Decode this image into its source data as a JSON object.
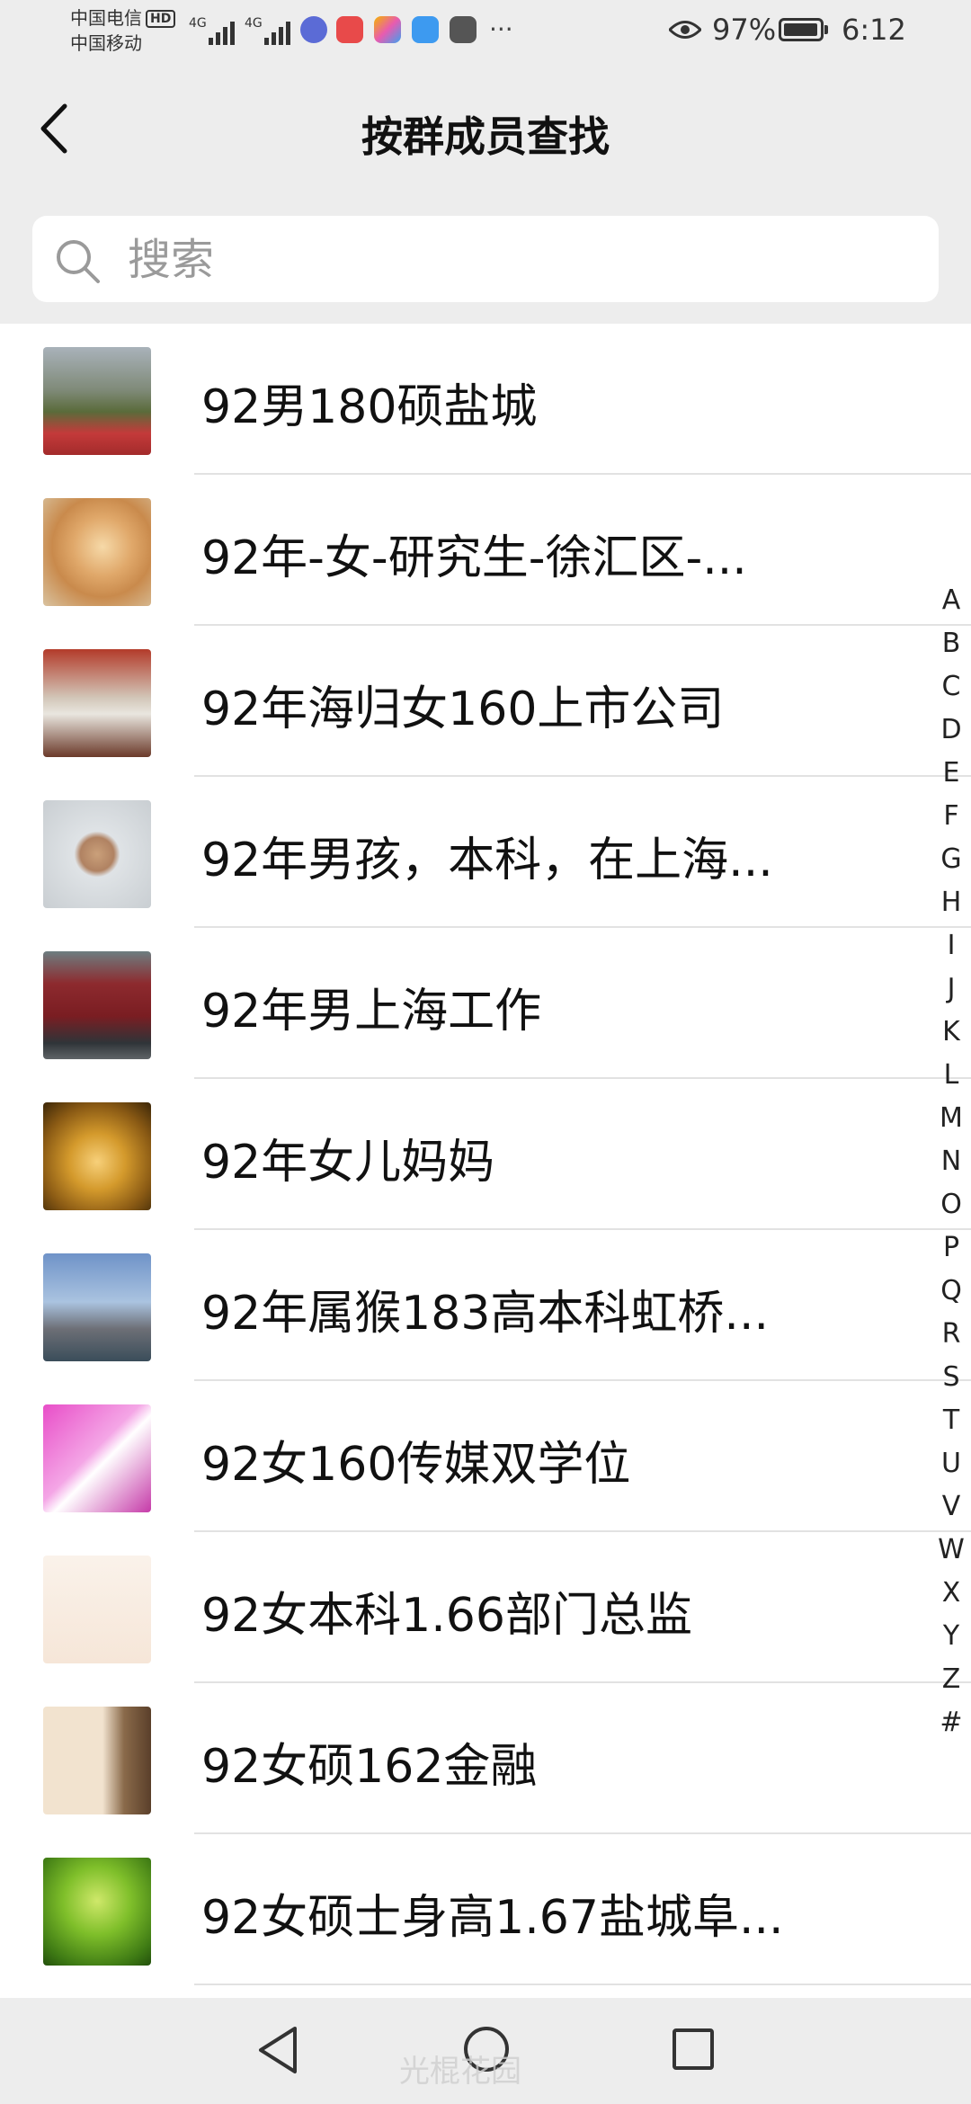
{
  "status_bar": {
    "carrier_1": "中国电信",
    "hd_badge": "HD",
    "carrier_2": "中国移动",
    "network_1": "4G",
    "network_2": "4G",
    "more": "···",
    "battery": "97%",
    "battery_level": 0.97,
    "time": "6:12"
  },
  "header": {
    "title": "按群成员查找"
  },
  "search": {
    "placeholder": "搜索",
    "value": ""
  },
  "members": [
    {
      "name": "92男180硕盐城",
      "avatar": "landscape-flowers"
    },
    {
      "name": "92年-女-研究生-徐汇区-...",
      "avatar": "kitten"
    },
    {
      "name": "92年海归女160上市公司",
      "avatar": "painting-waterfall"
    },
    {
      "name": "92年男孩，本科，在上海...",
      "avatar": "man-portrait"
    },
    {
      "name": "92年男上海工作",
      "avatar": "truck"
    },
    {
      "name": "92年女儿妈妈",
      "avatar": "golden-apple"
    },
    {
      "name": "92年属猴183高本科虹桥...",
      "avatar": "city-skyline"
    },
    {
      "name": "92女160传媒双学位",
      "avatar": "pink-studio"
    },
    {
      "name": "92女本科1.66部门总监",
      "avatar": "nice-text"
    },
    {
      "name": "92女硕162金融",
      "avatar": "cartoon-glasses"
    },
    {
      "name": "92女硕士身高1.67盐城阜...",
      "avatar": "green-leaves"
    }
  ],
  "index_letters": [
    "A",
    "B",
    "C",
    "D",
    "E",
    "F",
    "G",
    "H",
    "I",
    "J",
    "K",
    "L",
    "M",
    "N",
    "O",
    "P",
    "Q",
    "R",
    "S",
    "T",
    "U",
    "V",
    "W",
    "X",
    "Y",
    "Z",
    "#"
  ],
  "watermark": "光棍花园"
}
